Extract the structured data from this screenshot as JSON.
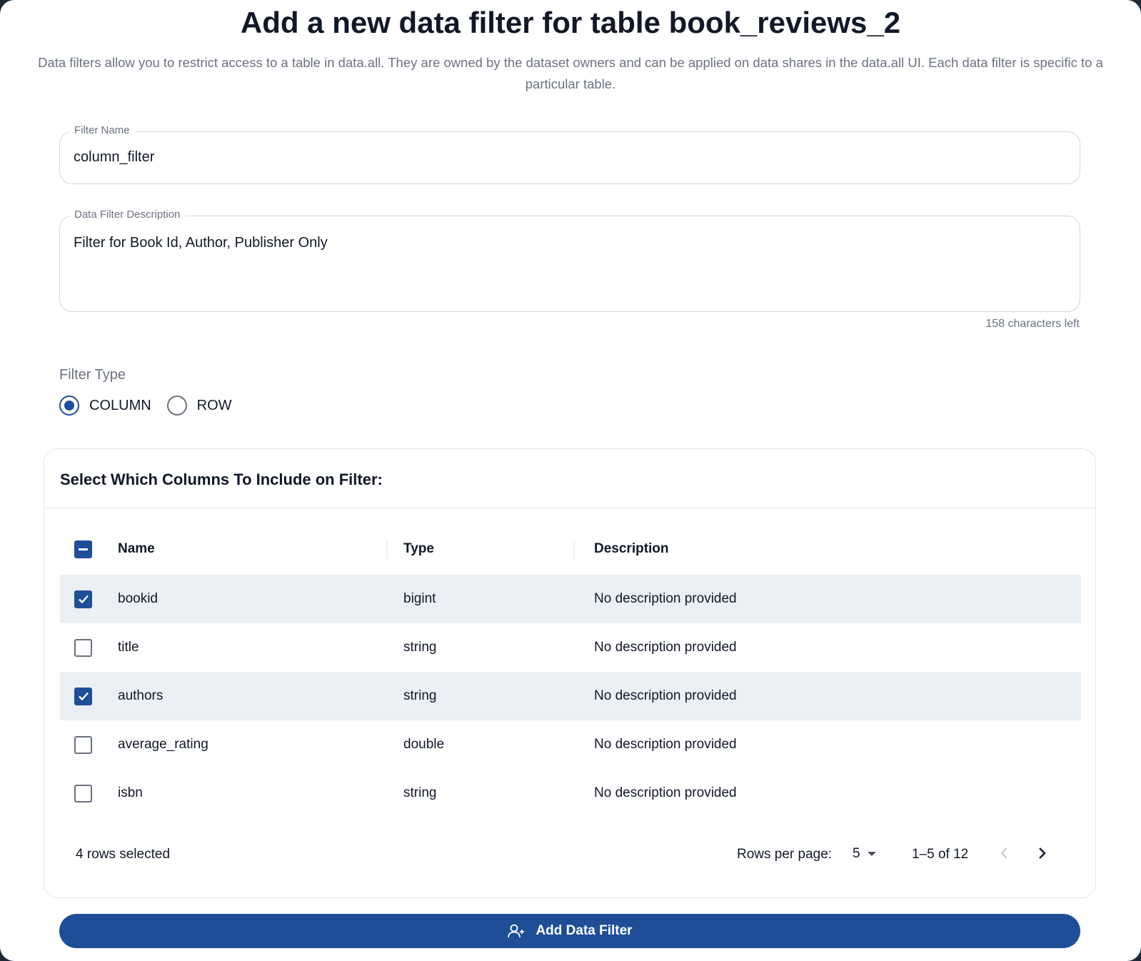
{
  "dialog": {
    "title": "Add a new data filter for table book_reviews_2",
    "subtitle": "Data filters allow you to restrict access to a table in data.all. They are owned by the dataset owners and can be applied on data shares in the data.all UI. Each data filter is specific to a particular table."
  },
  "form": {
    "filter_name": {
      "label": "Filter Name",
      "value": "column_filter"
    },
    "description": {
      "label": "Data Filter Description",
      "value": "Filter for Book Id, Author, Publisher Only",
      "helper": "158 characters left"
    },
    "filter_type": {
      "label": "Filter Type",
      "options": [
        {
          "label": "COLUMN",
          "checked": true
        },
        {
          "label": "ROW",
          "checked": false
        }
      ]
    }
  },
  "columns_card": {
    "title": "Select Which Columns To Include on Filter:",
    "headers": {
      "name": "Name",
      "type": "Type",
      "description": "Description"
    },
    "rows": [
      {
        "name": "bookid",
        "type": "bigint",
        "description": "No description provided",
        "selected": true
      },
      {
        "name": "title",
        "type": "string",
        "description": "No description provided",
        "selected": false
      },
      {
        "name": "authors",
        "type": "string",
        "description": "No description provided",
        "selected": true
      },
      {
        "name": "average_rating",
        "type": "double",
        "description": "No description provided",
        "selected": false
      },
      {
        "name": "isbn",
        "type": "string",
        "description": "No description provided",
        "selected": false
      }
    ],
    "footer": {
      "selected_text": "4 rows selected",
      "rows_per_page_label": "Rows per page:",
      "rows_per_page_value": "5",
      "range": "1–5 of 12"
    }
  },
  "submit": {
    "label": "Add Data Filter",
    "icon": "add-user-icon"
  },
  "colors": {
    "primary": "#1f4e96",
    "selected_row": "#ebf0f5",
    "muted_text": "#6b7280"
  }
}
